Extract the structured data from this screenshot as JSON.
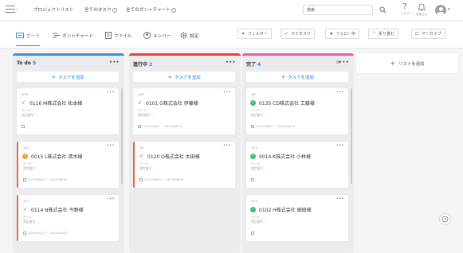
{
  "header": {
    "nav_links": [
      {
        "label": "プロジェクトリスト"
      },
      {
        "label": "全てのタスク"
      },
      {
        "label": "全てのガントチャート"
      }
    ],
    "search": {
      "value": "検索"
    },
    "help_label": "ヘルプ",
    "notification_label": "お知らせ"
  },
  "toolbar": {
    "view_tabs": [
      {
        "label": "ボード",
        "icon": "board-icon",
        "active": true
      },
      {
        "label": "ガントチャート",
        "icon": "gantt-icon"
      },
      {
        "label": "ファイル",
        "icon": "file-icon"
      },
      {
        "label": "メンバー",
        "icon": "member-icon"
      },
      {
        "label": "設定",
        "icon": "gear-icon"
      }
    ],
    "actions": [
      {
        "label": "フィルター",
        "icon": "filter-icon"
      },
      {
        "label": "マイタスク",
        "icon": "check-icon"
      },
      {
        "label": "フォロー中",
        "icon": "star-icon"
      },
      {
        "label": "折り畳む",
        "icon": "collapse-icon"
      },
      {
        "label": "アーカイブ",
        "icon": "archive-icon"
      }
    ]
  },
  "board": {
    "add_task_label": "タスクを追加",
    "add_list_label": "リストを追加",
    "columns": [
      {
        "name": "To do",
        "count": "5",
        "color": "#3f8ed8",
        "cards": [
          {
            "id": "#19",
            "title": "0116 M株式会社 松本様",
            "status": "check-blue",
            "meta1": "メール：",
            "meta2": "電話番号：--",
            "date": "",
            "highlight": false
          },
          {
            "id": "#11",
            "title": "0015 L株式会社 清水様",
            "status": "warn",
            "meta1": "メール：",
            "meta2": "電話番号：--",
            "date": "2023/06/01 ~ 2023/06/30",
            "highlight": true
          },
          {
            "id": "#17",
            "title": "0114 N株式会社 今野様",
            "status": "check-red",
            "meta1": "メール：",
            "meta2": "電話番号：--",
            "date": "2023/05/22 ~ 2023/05/22",
            "highlight": true
          }
        ]
      },
      {
        "name": "進行中",
        "count": "2",
        "color": "#e0453a",
        "cards": [
          {
            "id": "#19",
            "title": "0101 G株式会社 伊藤様",
            "status": "check-blue",
            "meta1": "メール：",
            "meta2": "電話番号：--",
            "date": "2023/06/01 ~ 2023/06/19",
            "highlight": false
          },
          {
            "id": "#5",
            "title": "0120 O株式会社 太田様",
            "status": "check-red",
            "meta1": "メール：",
            "meta2": "電話番号：--",
            "date": "2023/06/03 ~ 2023/06/05",
            "highlight": true
          }
        ]
      },
      {
        "name": "完了",
        "count": "4",
        "color": "#ec5fa8",
        "cards": [
          {
            "id": "#8",
            "title": "0135 CD株式会社 工藤様",
            "status": "done",
            "meta1": "メール：",
            "meta2": "電話番号：--",
            "date": "2023/06/02 ~ 2023/06/15",
            "highlight": false
          },
          {
            "id": "#20",
            "title": "0014 K株式会社 小林様",
            "status": "done",
            "meta1": "メール：",
            "meta2": "電話番号：--",
            "date": "",
            "highlight": false
          },
          {
            "id": "#10",
            "title": "0102 H株式会社 細田様",
            "status": "done",
            "meta1": "メール：",
            "meta2": "電話番号：--",
            "date": "",
            "highlight": false
          }
        ]
      }
    ]
  }
}
